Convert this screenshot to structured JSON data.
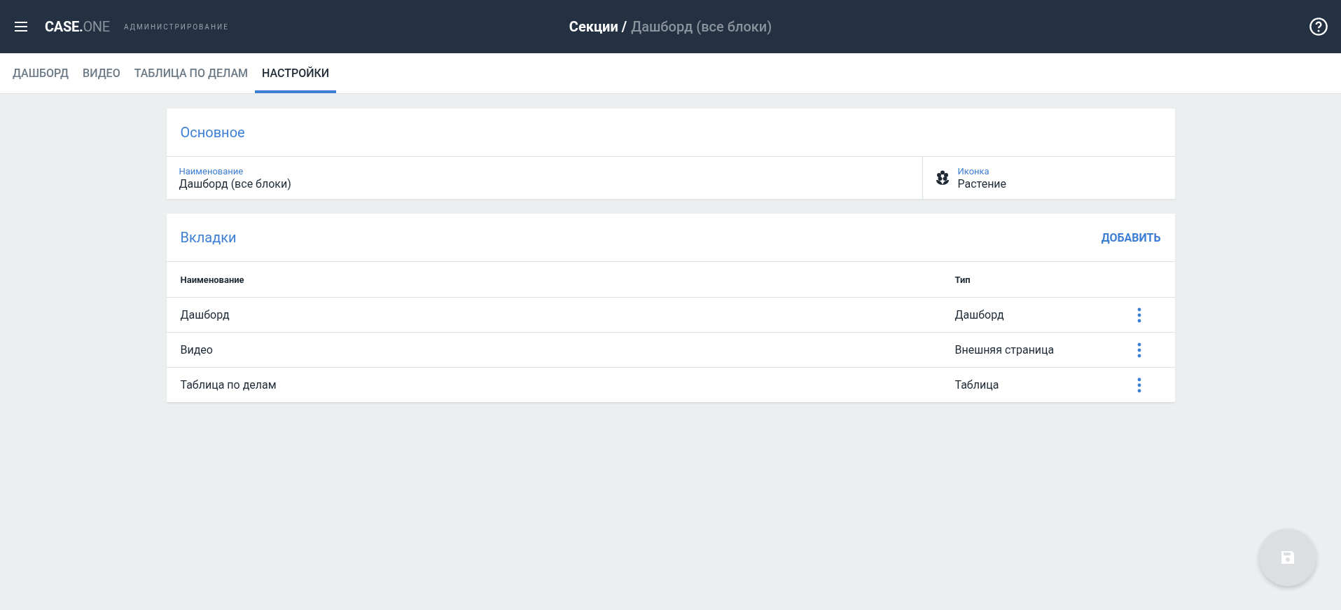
{
  "header": {
    "logo": {
      "primary": "CASE.",
      "secondary": "ONE"
    },
    "subtitle": "АДМИНИСТРИРОВАНИЕ",
    "breadcrumb": [
      {
        "label": "Секции /",
        "current": false
      },
      {
        "label": "Дашборд (все блоки)",
        "current": true
      }
    ]
  },
  "tabs": [
    {
      "label": "ДАШБОРД",
      "selected": false
    },
    {
      "label": "ВИДЕО",
      "selected": false
    },
    {
      "label": "ТАБЛИЦА ПО ДЕЛАМ",
      "selected": false
    },
    {
      "label": "НАСТРОЙКИ",
      "selected": true
    }
  ],
  "main_card": {
    "title": "Основное",
    "fields": [
      {
        "kind": "text",
        "label": "Наименование",
        "value": "Дашборд (все блоки)"
      },
      {
        "kind": "icon",
        "label": "Иконка",
        "value": "Растение"
      }
    ]
  },
  "tabs_card": {
    "title": "Вкладки",
    "action": "ДОБАВИТЬ",
    "columns": [
      "Наименование",
      "Тип"
    ],
    "rows": [
      {
        "name": "Дашборд",
        "type": "Дашборд"
      },
      {
        "name": "Видео",
        "type": "Внешняя страница"
      },
      {
        "name": "Таблица по делам",
        "type": "Таблица"
      }
    ]
  },
  "save_button": {
    "disabled": true
  }
}
